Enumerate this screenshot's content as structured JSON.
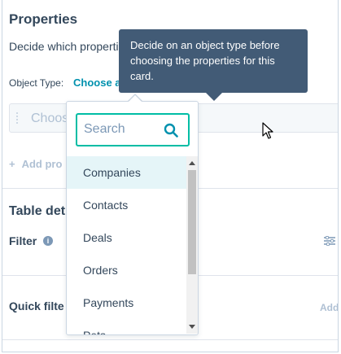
{
  "properties": {
    "title": "Properties",
    "description": "Decide which properties",
    "object_type_label": "Object Type:",
    "object_type_link": "Choose an",
    "choose_placeholder": "Choose",
    "add_property": "Add pro"
  },
  "tooltip": {
    "text": "Decide on an object type before choosing the properties for this card."
  },
  "dropdown": {
    "search_placeholder": "Search",
    "items": [
      {
        "label": "Companies"
      },
      {
        "label": "Contacts"
      },
      {
        "label": "Deals"
      },
      {
        "label": "Orders"
      },
      {
        "label": "Payments"
      },
      {
        "label": "Pets"
      }
    ]
  },
  "table": {
    "section_title": "Table det",
    "filter_label": "Filter",
    "quick_filter_label": "Quick filte",
    "add_link": "Add"
  },
  "colors": {
    "accent_teal": "#00bda5",
    "link": "#0091ae",
    "tooltip_bg": "#425b76",
    "text": "#33475b",
    "selected_bg": "#e5f5f8"
  }
}
